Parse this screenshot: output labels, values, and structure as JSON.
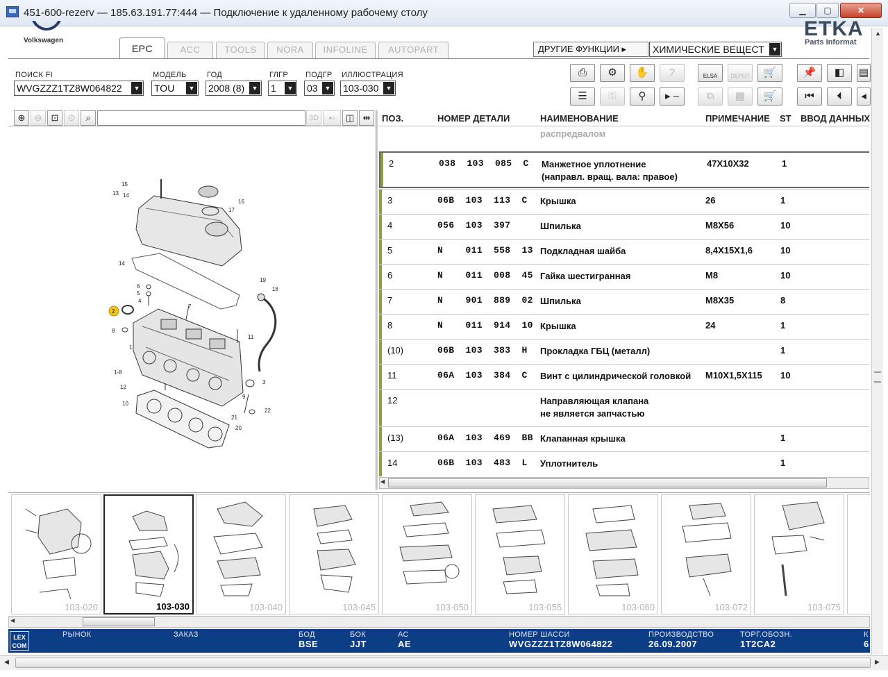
{
  "window": {
    "title": "451-600-rezerv — 185.63.191.77:444 — Подключение к удаленному рабочему столу",
    "min_glyph": "▁",
    "max_glyph": "▢",
    "close_glyph": "✕"
  },
  "brand": {
    "vw_name": "Volkswagen",
    "etka": "ETKA",
    "etka_sub": "Parts Informat"
  },
  "tabs": [
    {
      "label": "EPC",
      "active": true
    },
    {
      "label": "ACC"
    },
    {
      "label": "TOOLS"
    },
    {
      "label": "NORA"
    },
    {
      "label": "INFOLINE"
    },
    {
      "label": "AUTOPART"
    }
  ],
  "other_functions": {
    "label": "ДРУГИЕ ФУНКЦИИ ▸",
    "value": "ХИМИЧЕСКИЕ ВЕЩЕСТ"
  },
  "fields": {
    "search_fi": {
      "label": "ПОИСК FI",
      "value": "WVGZZZ1TZ8W064822"
    },
    "model": {
      "label": "МОДЕЛЬ",
      "value": "TOU"
    },
    "year": {
      "label": "ГОД",
      "value": "2008 (8)"
    },
    "main_group": {
      "label": "ГЛГР",
      "value": "1"
    },
    "sub_group": {
      "label": "ПОДГР",
      "value": "03"
    },
    "illustration": {
      "label": "ИЛЛЮСТРАЦИЯ",
      "value": "103-030"
    }
  },
  "toolbar_labels": {
    "elsa": "ELSA",
    "depot": "DEPOT"
  },
  "illus_tools": {
    "three_d": "3D"
  },
  "table": {
    "headers": {
      "pos": "ПОЗ.",
      "part_no": "НОМЕР ДЕТАЛИ",
      "name": "НАИМЕНОВАНИЕ",
      "note": "ПРИМЕЧАНИЕ",
      "st": "ST",
      "data_entry": "ВВОД ДАННЫХ"
    },
    "partial_row": "распредвалом",
    "rows": [
      {
        "pos": "2",
        "part": "038  103  085  C",
        "name": "Манжетное уплотнение",
        "name2": "(направл. вращ. вала: правое)",
        "note": "47X10X32",
        "st": "1"
      },
      {
        "pos": "3",
        "part": "06B  103  113  C",
        "name": "Крышка",
        "name2": "",
        "note": "26",
        "st": "1"
      },
      {
        "pos": "4",
        "part": "056  103  397",
        "name": "Шпилька",
        "name2": "",
        "note": "M8X56",
        "st": "10"
      },
      {
        "pos": "5",
        "part": "N    011  558  13",
        "name": "Подкладная шайба",
        "name2": "",
        "note": "8,4X15X1,6",
        "st": "10"
      },
      {
        "pos": "6",
        "part": "N    011  008  45",
        "name": "Гайка шестигранная",
        "name2": "",
        "note": "M8",
        "st": "10"
      },
      {
        "pos": "7",
        "part": "N    901  889  02",
        "name": "Шпилька",
        "name2": "",
        "note": "M8X35",
        "st": "8"
      },
      {
        "pos": "8",
        "part": "N    011  914  10",
        "name": "Крышка",
        "name2": "",
        "note": "24",
        "st": "1"
      },
      {
        "pos": "(10)",
        "part": "06B  103  383  H",
        "name": "Прокладка ГБЦ (металл)",
        "name2": "",
        "note": "",
        "st": "1"
      },
      {
        "pos": "11",
        "part": "06A  103  384  C",
        "name": "Винт с цилиндрической головкой",
        "name2": "",
        "note": "M10X1,5X115",
        "st": "10"
      },
      {
        "pos": "12",
        "part": "",
        "name": "Направляющая клапана",
        "name2": "не является запчастью",
        "note": "",
        "st": ""
      },
      {
        "pos": "(13)",
        "part": "06A  103  469  BB",
        "name": "Клапанная крышка",
        "name2": "",
        "note": "",
        "st": "1"
      },
      {
        "pos": "14",
        "part": "06B  103  483  L",
        "name": "Уплотнитель",
        "name2": "",
        "note": "",
        "st": "1"
      }
    ]
  },
  "diagram": {
    "callouts": [
      "15",
      "13",
      "14",
      "16",
      "17",
      "14",
      "19",
      "18",
      "6",
      "5",
      "4",
      "7",
      "2",
      "8",
      "1",
      "11",
      "1-8",
      "12",
      "3",
      "10",
      "9",
      "21",
      "20",
      "22"
    ],
    "selected_callout": "2"
  },
  "thumbnails": [
    "103-020",
    "103-030",
    "103-040",
    "103-045",
    "103-050",
    "103-055",
    "103-060",
    "103-072",
    "103-075"
  ],
  "active_thumbnail": "103-030",
  "status": {
    "logo": "LEX COM",
    "market": {
      "label": "РЫНОК",
      "value": ""
    },
    "order": {
      "label": "ЗАКАЗ",
      "value": ""
    },
    "bod": {
      "label": "БОД",
      "value": "BSE"
    },
    "bok": {
      "label": "БОК",
      "value": "JJT"
    },
    "ac": {
      "label": "АС",
      "value": "AE"
    },
    "chassis": {
      "label": "НОМЕР ШАССИ",
      "value": "WVGZZZ1TZ8W064822"
    },
    "production": {
      "label": "ПРОИЗВОДСТВО",
      "value": "26.09.2007"
    },
    "trade": {
      "label": "ТОРГ.ОБОЗН.",
      "value": "1T2CA2"
    },
    "cut_label": "К",
    "cut_value": "6"
  }
}
